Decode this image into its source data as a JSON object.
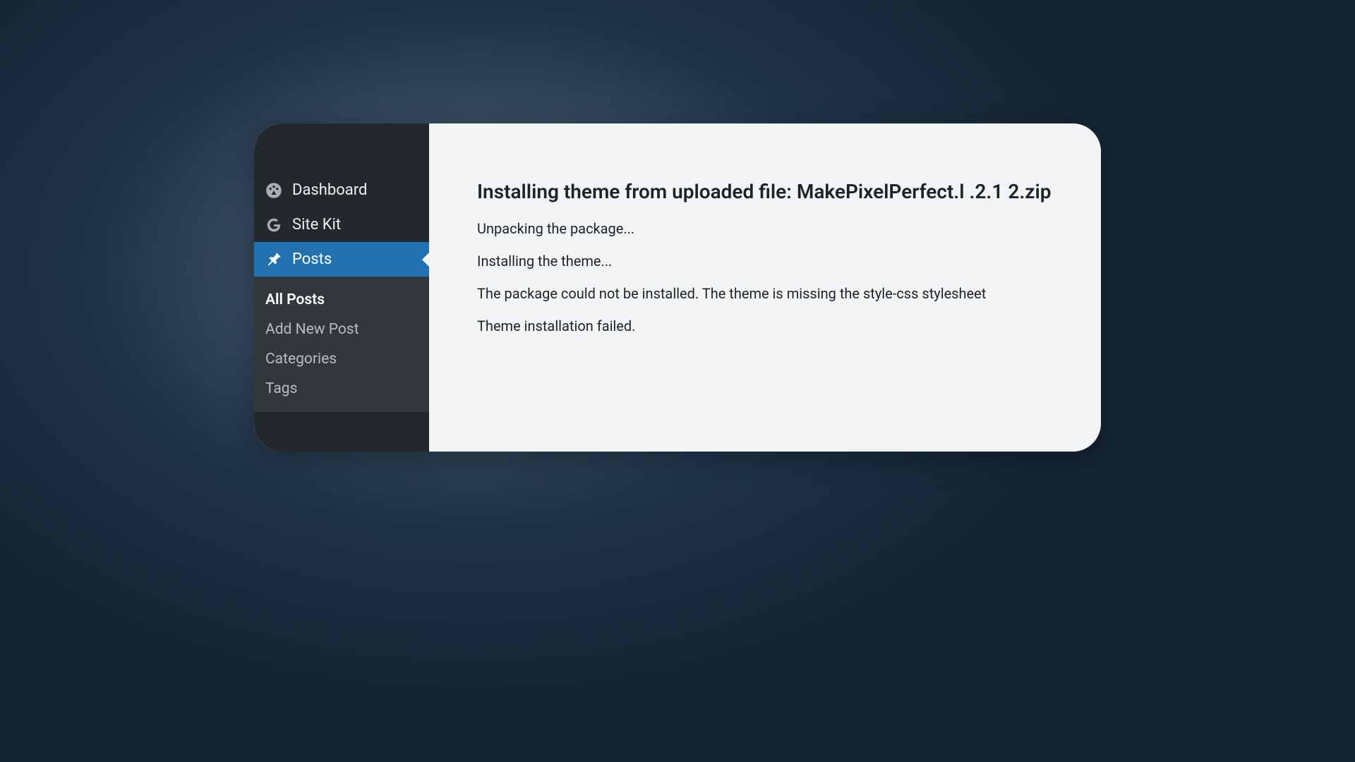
{
  "sidebar": {
    "items": [
      {
        "label": "Dashboard"
      },
      {
        "label": "Site Kit"
      },
      {
        "label": "Posts"
      }
    ],
    "submenu": [
      {
        "label": "All Posts"
      },
      {
        "label": "Add New Post"
      },
      {
        "label": "Categories"
      },
      {
        "label": "Tags"
      }
    ]
  },
  "content": {
    "title": "Installing theme from uploaded file: MakePixelPerfect.l .2.1 2.zip",
    "lines": [
      "Unpacking the package...",
      "Installing the theme...",
      "The package could not be installed. The theme is missing the style-css stylesheet",
      "Theme installation failed."
    ]
  }
}
